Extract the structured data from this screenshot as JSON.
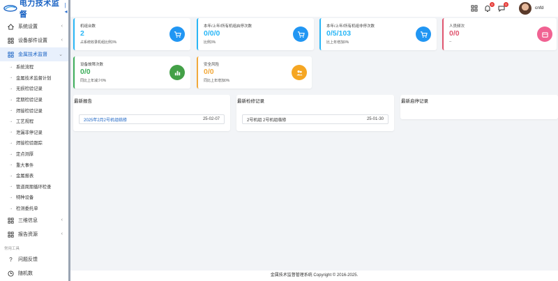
{
  "app": {
    "title": "电力技术监督"
  },
  "sidebar": {
    "items": [
      {
        "label": "系统设置",
        "chev": "‹"
      },
      {
        "label": "设备部件设置",
        "chev": "‹"
      },
      {
        "label": "金属技术监督",
        "chev": "⌄"
      }
    ],
    "subitems": [
      "系统流程",
      "金属技术监督计划",
      "无损检验记录",
      "定期检验记录",
      "焊接检验记录",
      "工艺规程",
      "泄漏非停记录",
      "焊接检验跟踪",
      "定点测厚",
      "重大事件",
      "金属报表",
      "管道周期循环检查",
      "特种设备",
      "检测委托单"
    ],
    "items2": [
      {
        "label": "三维信息",
        "chev": "‹"
      },
      {
        "label": "报告资源",
        "chev": "‹"
      }
    ],
    "section_label": "常用工具",
    "tools": [
      {
        "label": "问题反馈"
      },
      {
        "label": "随机数"
      }
    ]
  },
  "header": {
    "badge_bell": "0",
    "badge_msg": "0",
    "username": "cnfd"
  },
  "stats": [
    {
      "label": "机组台数",
      "value": "2",
      "sub": "占系统收录机组比例3%",
      "color": "#29b6f6",
      "icon": "cart-icon"
    },
    {
      "label": "本年/上年/所有机组启停次数",
      "value": "0/0/0",
      "sub": "比例3%",
      "color": "#29b6f6",
      "icon": "cart-icon"
    },
    {
      "label": "本年/上年/所有机组非停次数",
      "value": "0/5/103",
      "sub": "比上年增加0%",
      "color": "#29b6f6",
      "icon": "cart-icon"
    },
    {
      "label": "人员频次",
      "value": "0/0",
      "sub": "--",
      "color": "#e0556f",
      "icon": "calendar-icon"
    },
    {
      "label": "设备故障次数",
      "value": "0/0",
      "sub": "同比上年减少0%",
      "color": "#3eae5b",
      "icon": "bar-chart-icon"
    },
    {
      "label": "安全风险",
      "value": "0/0",
      "sub": "同比上年增加0%",
      "color": "#f2a93b",
      "icon": "users-icon"
    }
  ],
  "panels": [
    {
      "title": "最新报告",
      "row_text": "2025年2月2号机组临修",
      "row_date": "25-02-07"
    },
    {
      "title": "最新检修记录",
      "row_text": "2号机组 2号机组临修",
      "row_date": "25-01-30"
    },
    {
      "title": "最新启停记录"
    }
  ],
  "footer": {
    "text": "金属技术监督管理系统 Copyright © 2016-2025."
  }
}
